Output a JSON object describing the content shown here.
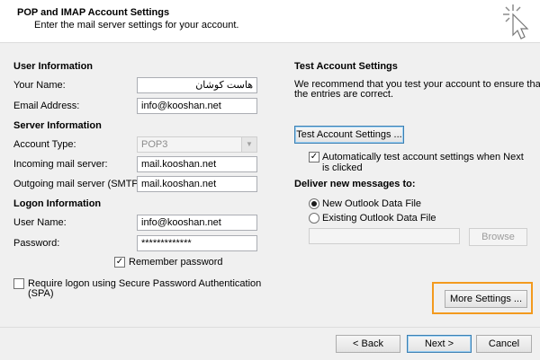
{
  "header": {
    "title": "POP and IMAP Account Settings",
    "subtitle": "Enter the mail server settings for your account."
  },
  "user_info": {
    "heading": "User Information",
    "name_label": "Your Name:",
    "name_value": "هاست کوشان",
    "email_label": "Email Address:",
    "email_value": "info@kooshan.net"
  },
  "server_info": {
    "heading": "Server Information",
    "account_type_label": "Account Type:",
    "account_type_value": "POP3",
    "incoming_label": "Incoming mail server:",
    "incoming_value": "mail.kooshan.net",
    "outgoing_label": "Outgoing mail server (SMTP):",
    "outgoing_value": "mail.kooshan.net"
  },
  "logon_info": {
    "heading": "Logon Information",
    "username_label": "User Name:",
    "username_value": "info@kooshan.net",
    "password_label": "Password:",
    "password_value": "*************",
    "remember_label": "Remember password",
    "remember_checked": true,
    "spa_label_line1": "Require logon using Secure Password Authentication",
    "spa_label_line2": "(SPA)",
    "spa_checked": false
  },
  "test": {
    "heading": "Test Account Settings",
    "description_line1": "We recommend that you test your account to ensure that",
    "description_line2": "the entries are correct.",
    "test_button": "Test Account Settings ...",
    "auto_test_line1": "Automatically test account settings when Next",
    "auto_test_line2": "is clicked",
    "auto_test_checked": true
  },
  "deliver": {
    "heading": "Deliver new messages to:",
    "new_file_label": "New Outlook Data File",
    "existing_file_label": "Existing Outlook Data File",
    "selected": "new",
    "existing_path": "",
    "browse_button": "Browse"
  },
  "more_settings_button": "More Settings ...",
  "footer": {
    "back": "< Back",
    "next": "Next >",
    "cancel": "Cancel"
  },
  "colors": {
    "highlight": "#f39a1e",
    "focus_border": "#3c7fb1"
  }
}
